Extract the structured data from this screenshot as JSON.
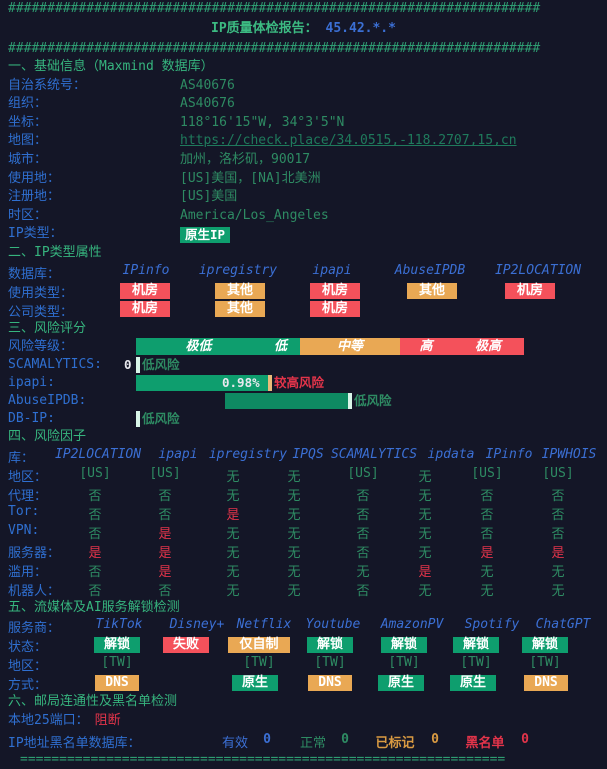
{
  "header": {
    "hash_line": "####################################################################",
    "title_label": "IP质量体检报告：",
    "title_ip": "45.42.*.*"
  },
  "section1": {
    "heading": "一、基础信息（Maxmind 数据库）",
    "rows": [
      {
        "label": "自治系统号：",
        "value": "AS40676"
      },
      {
        "label": "组织：",
        "value": "AS40676"
      },
      {
        "label": "坐标：",
        "value": "118°16'15\"W, 34°3'5\"N"
      },
      {
        "label": "地图：",
        "value": "https://check.place/34.0515,-118.2707,15,cn"
      },
      {
        "label": "城市：",
        "value": "加州，洛杉矶，90017"
      },
      {
        "label": "使用地：",
        "value": "[US]美国，[NA]北美洲"
      },
      {
        "label": "注册地：",
        "value": "[US]美国"
      },
      {
        "label": "时区：",
        "value": "America/Los_Angeles"
      },
      {
        "label": "IP类型：",
        "value": "原生IP"
      }
    ]
  },
  "section2": {
    "heading": "二、IP类型属性",
    "db_label": "数据库：",
    "databases": [
      "IPinfo",
      "ipregistry",
      "ipapi",
      "AbuseIPDB",
      "IP2LOCATION"
    ],
    "rows": [
      {
        "label": "使用类型：",
        "values": [
          "机房",
          "其他",
          "机房",
          "其他",
          "机房"
        ],
        "colors": [
          "red",
          "orange",
          "red",
          "orange",
          "red"
        ]
      },
      {
        "label": "公司类型：",
        "values": [
          "机房",
          "其他",
          "机房",
          "",
          ""
        ],
        "colors": [
          "red",
          "orange",
          "red",
          "",
          ""
        ]
      }
    ]
  },
  "section3": {
    "heading": "三、风险评分",
    "legend_label": "风险等级：",
    "legend": [
      {
        "text": "极低",
        "color": "#0e9e6e"
      },
      {
        "text": "低",
        "color": "#0e9e6e"
      },
      {
        "text": "中等",
        "color": "#e9a854"
      },
      {
        "text": "高",
        "color": "#f4515b"
      },
      {
        "text": "极高",
        "color": "#f4515b"
      }
    ],
    "scores": [
      {
        "label": "SCAMALYTICS:",
        "score": "0",
        "verdict": "低风险",
        "verdict_color": "#2e8b63"
      },
      {
        "label": "ipapi:",
        "score": "0.98%",
        "verdict": "较高风险",
        "verdict_color": "#e3344a"
      },
      {
        "label": "AbuseIPDB:",
        "score": "",
        "verdict": "低风险",
        "verdict_color": "#2e8b63"
      },
      {
        "label": "DB-IP:",
        "score": "",
        "verdict": "低风险",
        "verdict_color": "#2e8b63"
      }
    ]
  },
  "section4": {
    "heading": "四、风险因子",
    "db_label": "库：",
    "databases": [
      "IP2LOCATION",
      "ipapi",
      "ipregistry",
      "IPQS",
      "SCAMALYTICS",
      "ipdata",
      "IPinfo",
      "IPWHOIS"
    ],
    "rows": [
      {
        "label": "地区：",
        "values": [
          "[US]",
          "[US]",
          "无",
          "无",
          "[US]",
          "无",
          "[US]",
          "[US]"
        ],
        "colors": [
          "g",
          "g",
          "g",
          "g",
          "g",
          "g",
          "g",
          "g"
        ]
      },
      {
        "label": "代理：",
        "values": [
          "否",
          "否",
          "无",
          "无",
          "否",
          "无",
          "否",
          "否"
        ],
        "colors": [
          "g",
          "g",
          "g",
          "g",
          "g",
          "g",
          "g",
          "g"
        ]
      },
      {
        "label": "Tor:",
        "values": [
          "否",
          "否",
          "是",
          "无",
          "否",
          "无",
          "否",
          "否"
        ],
        "colors": [
          "g",
          "g",
          "r",
          "g",
          "g",
          "g",
          "g",
          "g"
        ]
      },
      {
        "label": "VPN:",
        "values": [
          "否",
          "是",
          "无",
          "无",
          "否",
          "无",
          "否",
          "否"
        ],
        "colors": [
          "g",
          "r",
          "g",
          "g",
          "g",
          "g",
          "g",
          "g"
        ]
      },
      {
        "label": "服务器：",
        "values": [
          "是",
          "是",
          "无",
          "无",
          "否",
          "无",
          "是",
          "是"
        ],
        "colors": [
          "r",
          "r",
          "g",
          "g",
          "g",
          "g",
          "r",
          "r"
        ]
      },
      {
        "label": "滥用：",
        "values": [
          "否",
          "是",
          "无",
          "无",
          "无",
          "是",
          "无",
          "无"
        ],
        "colors": [
          "g",
          "r",
          "g",
          "g",
          "g",
          "r",
          "g",
          "g"
        ]
      },
      {
        "label": "机器人：",
        "values": [
          "否",
          "否",
          "无",
          "无",
          "否",
          "无",
          "无",
          "无"
        ],
        "colors": [
          "g",
          "g",
          "g",
          "g",
          "g",
          "g",
          "g",
          "g"
        ]
      }
    ]
  },
  "section5": {
    "heading": "五、流媒体及AI服务解锁检测",
    "provider_label": "服务商：",
    "providers": [
      "TikTok",
      "Disney+",
      "Netflix",
      "Youtube",
      "AmazonPV",
      "Spotify",
      "ChatGPT"
    ],
    "status_label": "状态：",
    "status": [
      {
        "text": "解锁",
        "color": "green"
      },
      {
        "text": "失败",
        "color": "red"
      },
      {
        "text": "仅自制",
        "color": "orange"
      },
      {
        "text": "解锁",
        "color": "green"
      },
      {
        "text": "解锁",
        "color": "green"
      },
      {
        "text": "解锁",
        "color": "green"
      },
      {
        "text": "解锁",
        "color": "green"
      }
    ],
    "region_label": "地区：",
    "regions": [
      "[TW]",
      "",
      "[TW]",
      "[TW]",
      "[TW]",
      "[TW]",
      "[TW]"
    ],
    "method_label": "方式：",
    "methods": [
      {
        "text": "DNS",
        "color": "orange"
      },
      {
        "text": "",
        "color": ""
      },
      {
        "text": "原生",
        "color": "green"
      },
      {
        "text": "DNS",
        "color": "orange"
      },
      {
        "text": "原生",
        "color": "green"
      },
      {
        "text": "原生",
        "color": "green"
      },
      {
        "text": "DNS",
        "color": "orange"
      }
    ]
  },
  "section6": {
    "heading": "六、邮局连通性及黑名单检测",
    "port_label": "本地25端口：",
    "port_value": "阻断",
    "blacklist_label": "IP地址黑名单数据库：",
    "blacklist": [
      {
        "name": "有效",
        "count": "0",
        "name_color": "#3b6fd4",
        "count_color": "#3b6fd4"
      },
      {
        "name": "正常",
        "count": "0",
        "name_color": "#2e8b63",
        "count_color": "#2e8b63"
      },
      {
        "name": "已标记",
        "count": "0",
        "name_color": "#d99a42",
        "count_color": "#d99a42"
      },
      {
        "name": "黑名单",
        "count": "0",
        "name_color": "#e3344a",
        "count_color": "#e3344a"
      }
    ],
    "eq_line": "=============================================================="
  }
}
